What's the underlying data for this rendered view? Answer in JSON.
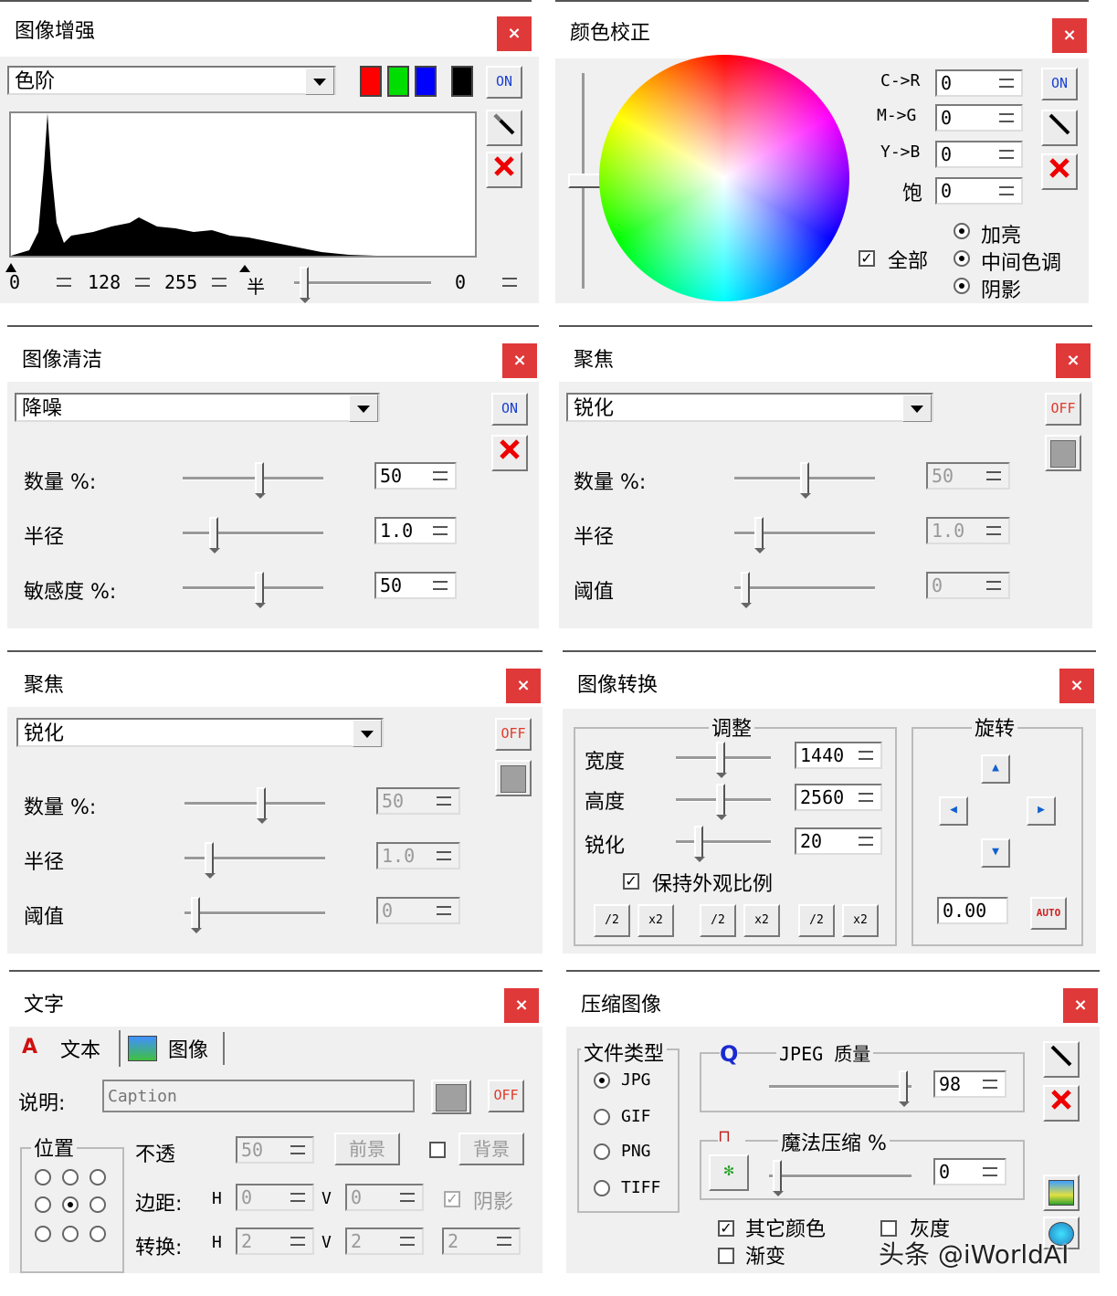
{
  "enhance": {
    "title": "图像增强",
    "mode": "色阶",
    "on_label": "ON",
    "colors": [
      "#ff0000",
      "#00dd00",
      "#0000ff",
      "#000000"
    ],
    "in_low": "0",
    "in_mid": "128",
    "in_high": "255",
    "half_label": "半",
    "out_value": "0",
    "close": "×"
  },
  "color": {
    "title": "颜色校正",
    "on_label": "ON",
    "c_r_label": "C->R",
    "c_r": "0",
    "m_g_label": "M->G",
    "m_g": "0",
    "y_b_label": "Y->B",
    "y_b": "0",
    "sat_label": "饱",
    "sat": "0",
    "all_label": "全部",
    "radio_bright": "加亮",
    "radio_mid": "中间色调",
    "radio_shadow": "阴影",
    "close": "×"
  },
  "clean": {
    "title": "图像清洁",
    "mode": "降噪",
    "on_label": "ON",
    "amount_label": "数量 %:",
    "amount": "50",
    "amount_level": 0.55,
    "radius_label": "半径",
    "radius": "1.0",
    "radius_level": 0.2,
    "sens_label": "敏感度 %:",
    "sens": "50",
    "sens_level": 0.55,
    "close": "×"
  },
  "focus1": {
    "title": "聚焦",
    "mode": "锐化",
    "off_label": "OFF",
    "amount_label": "数量 %:",
    "amount": "50",
    "amount_level": 0.5,
    "radius_label": "半径",
    "radius": "1.0",
    "radius_level": 0.15,
    "thresh_label": "阈值",
    "thresh": "0",
    "thresh_level": 0.05,
    "close": "×"
  },
  "focus2": {
    "title": "聚焦",
    "mode": "锐化",
    "off_label": "OFF",
    "amount_label": "数量 %:",
    "amount": "50",
    "amount_level": 0.55,
    "radius_label": "半径",
    "radius": "1.0",
    "radius_level": 0.15,
    "thresh_label": "阈值",
    "thresh": "0",
    "thresh_level": 0.05,
    "close": "×"
  },
  "convert": {
    "title": "图像转换",
    "adjust_label": "调整",
    "width_label": "宽度",
    "width": "1440",
    "height_label": "高度",
    "height": "2560",
    "sharp_label": "锐化",
    "sharp": "20",
    "keep_label": "保持外观比例",
    "btn1": "/2",
    "btn2": "x2",
    "btn3": "/2",
    "btn4": "x2",
    "btn5": "/2",
    "btn6": "x2",
    "rotate_label": "旋转",
    "angle": "0.00",
    "auto_label": "AUTO",
    "close": "×"
  },
  "text": {
    "title": "文字",
    "tab_text": "文本",
    "tab_image": "图像",
    "caption_label": "说明:",
    "caption_placeholder": "Caption",
    "off_label": "OFF",
    "position_label": "位置",
    "opacity_label": "不透",
    "opacity": "50",
    "fg_label": "前景",
    "bg_label": "背景",
    "margin_label": "边距:",
    "h_label": "H",
    "v_label": "V",
    "margin_h": "0",
    "margin_v": "0",
    "shadow_label": "阴影",
    "convert_label": "转换:",
    "conv_h": "2",
    "conv_v": "2",
    "conv_3": "2",
    "close": "×"
  },
  "compress": {
    "title": "压缩图像",
    "filetype_label": "文件类型",
    "types": [
      "JPG",
      "GIF",
      "PNG",
      "TIFF"
    ],
    "q_icon": "Q",
    "quality_label": "JPEG 质量",
    "quality": "98",
    "magic_label": "魔法压缩 %",
    "magic": "0",
    "other_colors": "其它颜色",
    "gray": "灰度",
    "gradient": "渐变",
    "close": "×"
  },
  "watermark": "头条 @iWorldAI"
}
